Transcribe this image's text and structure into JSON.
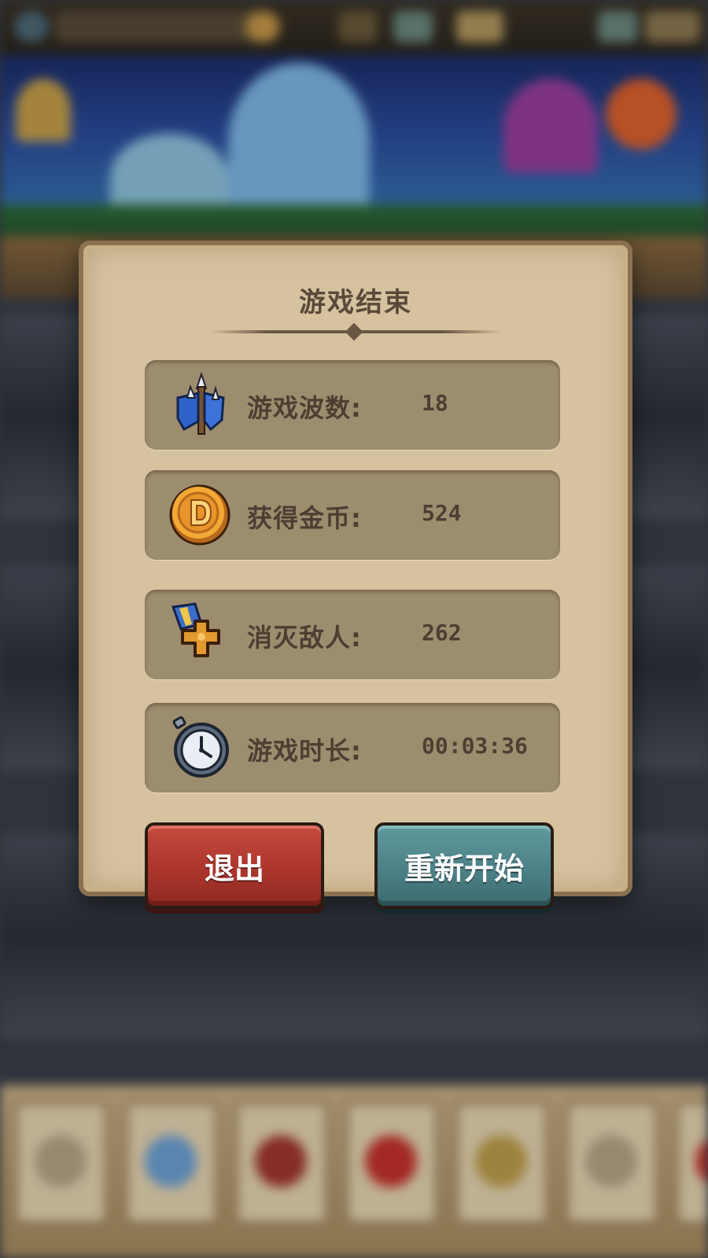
{
  "dialog": {
    "title": "游戏结束",
    "stats": [
      {
        "icon": "blue-flags-icon",
        "label": "游戏波数:",
        "value": "18"
      },
      {
        "icon": "gold-coin-icon",
        "label": "获得金币:",
        "value": "524"
      },
      {
        "icon": "medal-icon",
        "label": "消灭敌人:",
        "value": "262"
      },
      {
        "icon": "stopwatch-icon",
        "label": "游戏时长:",
        "value": "00:03:36"
      }
    ]
  },
  "buttons": {
    "exit_label": "退出",
    "restart_label": "重新开始"
  },
  "colors": {
    "exit_button": "#a9342b",
    "restart_button": "#4a7f84",
    "panel": "#d7c2a0",
    "row": "#9d8d6f",
    "text": "#4c3f32"
  }
}
